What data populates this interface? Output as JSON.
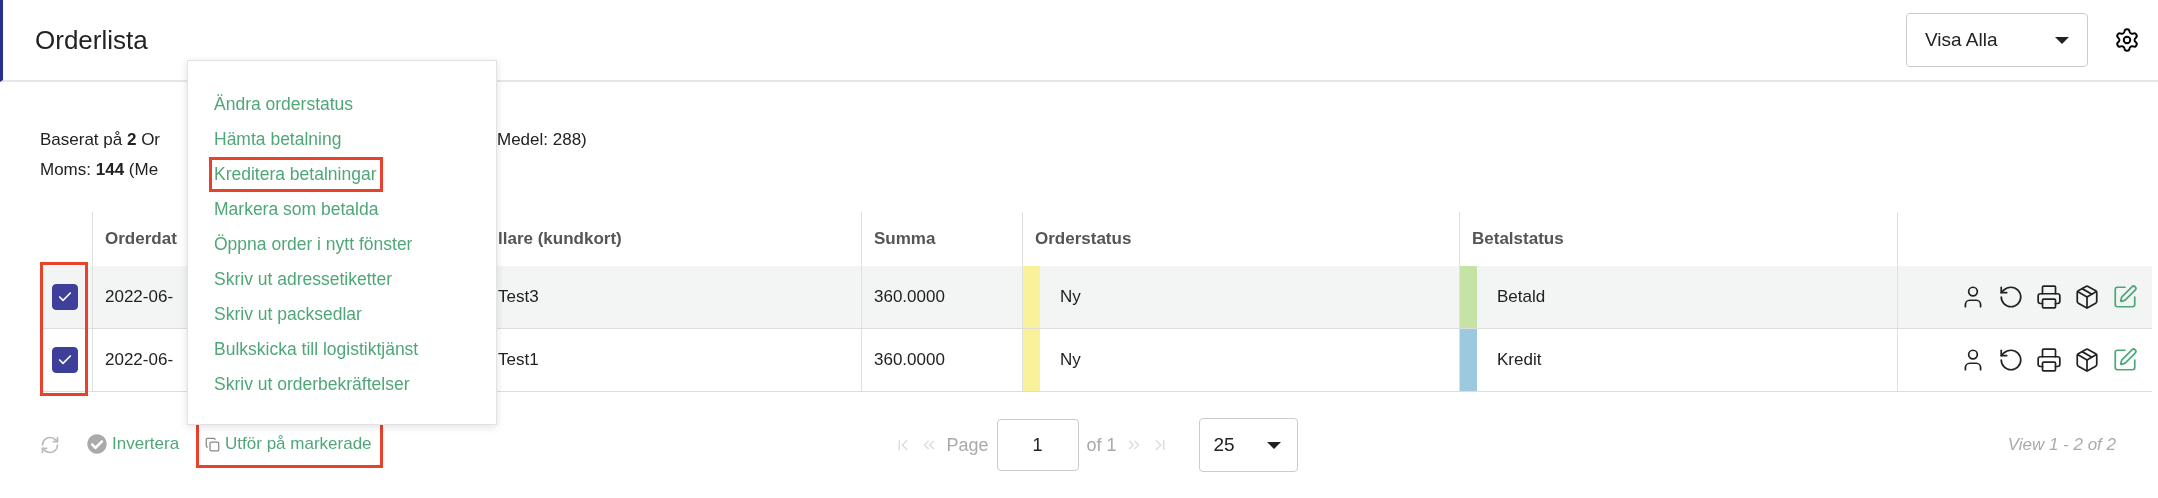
{
  "header": {
    "title": "Orderlista",
    "filter": {
      "value": "Visa Alla"
    }
  },
  "summary": {
    "lines": [
      {
        "left": "Baserat på **2** Or",
        "right": "Medel: 288)"
      },
      {
        "left": "Moms: **144** (Me"
      }
    ]
  },
  "menu": {
    "items": [
      {
        "label": "Ändra orderstatus",
        "highlighted": false
      },
      {
        "label": "Hämta betalning",
        "highlighted": false
      },
      {
        "label": "Kreditera betalningar",
        "highlighted": true
      },
      {
        "label": "Markera som betalda",
        "highlighted": false
      },
      {
        "label": "Öppna order i nytt fönster",
        "highlighted": false
      },
      {
        "label": "Skriv ut adressetiketter",
        "highlighted": false
      },
      {
        "label": "Skriv ut packsedlar",
        "highlighted": false
      },
      {
        "label": "Bulkskicka till logistiktjänst",
        "highlighted": false
      },
      {
        "label": "Skriv ut orderbekräftelser",
        "highlighted": false
      }
    ]
  },
  "table": {
    "checkbox_column_highlighted": true,
    "columns": [
      "Orderdat",
      "llare (kundkort)",
      "Summa",
      "Orderstatus",
      "Betalstatus"
    ],
    "rows": [
      {
        "checked": true,
        "hover": true,
        "date": "2022-06-",
        "customer": "Test3",
        "sum": "360.0000",
        "order_status": {
          "label": "Ny",
          "color": "#f9f29a"
        },
        "payment_status": {
          "label": "Betald",
          "color": "#c4e3a5"
        }
      },
      {
        "checked": true,
        "hover": false,
        "date": "2022-06-",
        "customer": "Test1",
        "sum": "360.0000",
        "order_status": {
          "label": "Ny",
          "color": "#f9f29a"
        },
        "payment_status": {
          "label": "Kredit",
          "color": "#9dc9df"
        }
      }
    ]
  },
  "footer": {
    "invert": "Invertera",
    "bulk_action": {
      "label": "Utför på markerade",
      "highlighted": true
    },
    "pager": {
      "page_label": "Page",
      "page": "1",
      "of": "of 1",
      "page_size": "25"
    },
    "view": "View 1 - 2 of 2"
  }
}
